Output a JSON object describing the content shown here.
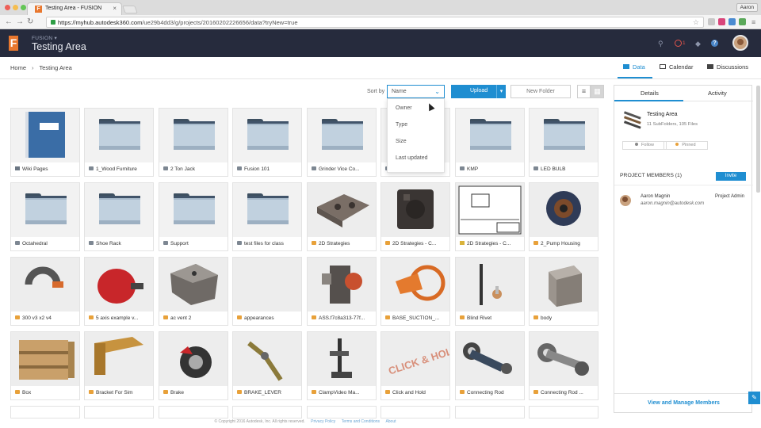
{
  "browser": {
    "tab_title": "Testing Area - FUSION",
    "user_button": "Aaron",
    "url_host": "https://myhub.autodesk360.com",
    "url_path": "/ue29b4dd3/g/projects/20160202226656/data?tryNew=true"
  },
  "header": {
    "app_label": "FUSION",
    "project_title": "Testing Area",
    "notification_count": "1"
  },
  "breadcrumb": [
    "Home",
    "Testing Area"
  ],
  "view_tabs": {
    "data": "Data",
    "calendar": "Calendar",
    "discussions": "Discussions"
  },
  "toolbar": {
    "sort_by_label": "Sort by",
    "sort_selected": "Name",
    "upload_label": "Upload",
    "new_folder_label": "New Folder"
  },
  "sort_options": [
    "Owner",
    "Type",
    "Size",
    "Last updated"
  ],
  "items": [
    {
      "name": "Wiki Pages",
      "type": "doc"
    },
    {
      "name": "1_Wood Furniture",
      "type": "folder"
    },
    {
      "name": "2 Ton Jack",
      "type": "folder"
    },
    {
      "name": "Fusion 101",
      "type": "folder"
    },
    {
      "name": "Grinder Vice Co...",
      "type": "folder"
    },
    {
      "name": "",
      "type": "folder"
    },
    {
      "name": "KMP",
      "type": "folder"
    },
    {
      "name": "LED BULB",
      "type": "folder"
    },
    {
      "name": "Octahedral",
      "type": "folder"
    },
    {
      "name": "Shoe Rack",
      "type": "folder"
    },
    {
      "name": "Support",
      "type": "folder"
    },
    {
      "name": "test files for class",
      "type": "folder"
    },
    {
      "name": "2D Strategies",
      "type": "model"
    },
    {
      "name": "2D Strategies - C...",
      "type": "model"
    },
    {
      "name": "2D Strategies - C...",
      "type": "drawing"
    },
    {
      "name": "2_Pump Housing",
      "type": "model"
    },
    {
      "name": "300 v3 x2 v4",
      "type": "model"
    },
    {
      "name": "5 axis example v...",
      "type": "model"
    },
    {
      "name": "ac vent 2",
      "type": "model"
    },
    {
      "name": "appearances",
      "type": "model"
    },
    {
      "name": "ASS.f7c8a313-77f...",
      "type": "model"
    },
    {
      "name": "BASE_SUCTION_...",
      "type": "model"
    },
    {
      "name": "Blind Rivet",
      "type": "model"
    },
    {
      "name": "body",
      "type": "model"
    },
    {
      "name": "Box",
      "type": "model"
    },
    {
      "name": "Bracket For Sim",
      "type": "model"
    },
    {
      "name": "Brake",
      "type": "model"
    },
    {
      "name": "BRAKE_LEVER",
      "type": "model"
    },
    {
      "name": "ClampVideo Ma...",
      "type": "model"
    },
    {
      "name": "Click and Hold",
      "type": "model"
    },
    {
      "name": "Connecting Rod",
      "type": "model"
    },
    {
      "name": "Connecting Rod ...",
      "type": "model"
    }
  ],
  "panel": {
    "tab_details": "Details",
    "tab_activity": "Activity",
    "project_name": "Testing Area",
    "project_meta": "11 SubFolders, 105 Files",
    "follow_label": "Follow",
    "pinned_label": "Pinned",
    "members_title": "PROJECT MEMBERS (1)",
    "invite_label": "Invite",
    "member_name": "Aaron Magnin",
    "member_email": "aaron.magnin@autodesk.com",
    "member_role": "Project Admin",
    "view_manage": "View and Manage Members"
  },
  "footer": {
    "copyright": "© Copyright 2016 Autodesk, Inc. All rights reserved.",
    "privacy": "Privacy Policy",
    "terms": "Terms and Conditions",
    "about": "About"
  },
  "colors": {
    "accent": "#1f8ed1",
    "header_bg": "#262b3d",
    "brand": "#e8772e"
  }
}
